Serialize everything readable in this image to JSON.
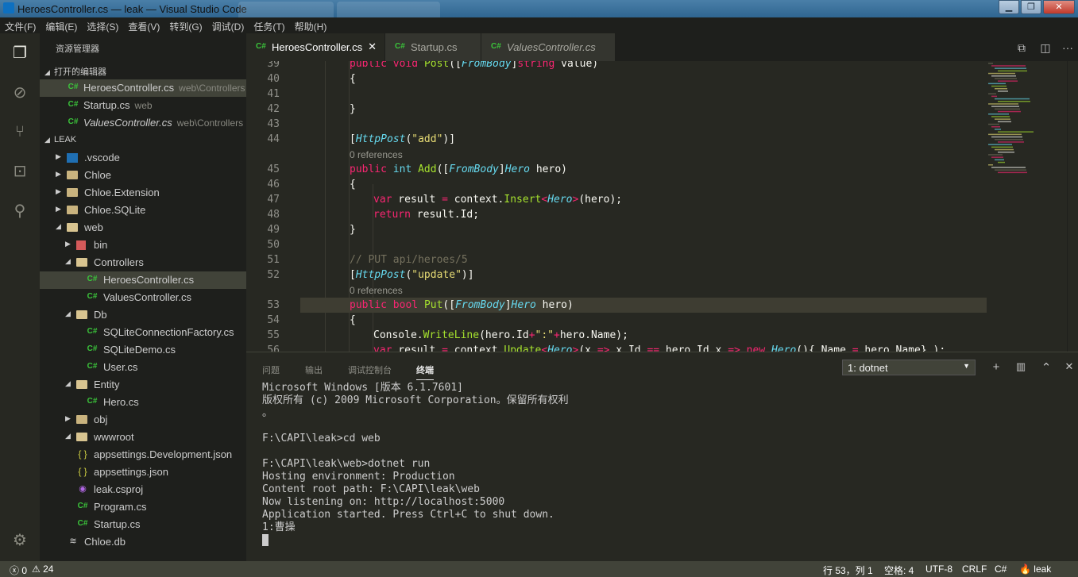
{
  "window": {
    "title": "HeroesController.cs — leak — Visual Studio Code",
    "controls": [
      "minimize",
      "maximize",
      "close"
    ]
  },
  "menu": [
    "文件(F)",
    "编辑(E)",
    "选择(S)",
    "查看(V)",
    "转到(G)",
    "调试(D)",
    "任务(T)",
    "帮助(H)"
  ],
  "activity": [
    "explorer-icon",
    "debug-icon",
    "source-control-icon",
    "extensions-icon",
    "search-icon",
    "gear-icon"
  ],
  "sidebar": {
    "title": "资源管理器",
    "open_editors_title": "打开的编辑器",
    "open_editors": [
      {
        "name": "HeroesController.cs",
        "desc": "web\\Controllers",
        "italic": false
      },
      {
        "name": "Startup.cs",
        "desc": "web",
        "italic": false
      },
      {
        "name": "ValuesController.cs",
        "desc": "web\\Controllers",
        "italic": true
      }
    ],
    "project_title": "LEAK",
    "tree": [
      {
        "name": ".vscode",
        "icon": "vscode",
        "depth": 1,
        "caret": "▶"
      },
      {
        "name": "Chloe",
        "icon": "folder",
        "depth": 1,
        "caret": "▶"
      },
      {
        "name": "Chloe.Extension",
        "icon": "folder",
        "depth": 1,
        "caret": "▶"
      },
      {
        "name": "Chloe.SQLite",
        "icon": "folder",
        "depth": 1,
        "caret": "▶"
      },
      {
        "name": "web",
        "icon": "folder-open",
        "depth": 1,
        "caret": "◢"
      },
      {
        "name": "bin",
        "icon": "bin",
        "depth": 2,
        "caret": "▶"
      },
      {
        "name": "Controllers",
        "icon": "folder-open",
        "depth": 2,
        "caret": "◢"
      },
      {
        "name": "HeroesController.cs",
        "icon": "cs",
        "depth": 3,
        "caret": "",
        "selected": true
      },
      {
        "name": "ValuesController.cs",
        "icon": "cs",
        "depth": 3,
        "caret": ""
      },
      {
        "name": "Db",
        "icon": "folder-open",
        "depth": 2,
        "caret": "◢"
      },
      {
        "name": "SQLiteConnectionFactory.cs",
        "icon": "cs",
        "depth": 3,
        "caret": ""
      },
      {
        "name": "SQLiteDemo.cs",
        "icon": "cs",
        "depth": 3,
        "caret": ""
      },
      {
        "name": "User.cs",
        "icon": "cs",
        "depth": 3,
        "caret": ""
      },
      {
        "name": "Entity",
        "icon": "folder-open",
        "depth": 2,
        "caret": "◢"
      },
      {
        "name": "Hero.cs",
        "icon": "cs",
        "depth": 3,
        "caret": ""
      },
      {
        "name": "obj",
        "icon": "folder",
        "depth": 2,
        "caret": "▶"
      },
      {
        "name": "wwwroot",
        "icon": "folder-open",
        "depth": 2,
        "caret": "◢"
      },
      {
        "name": "appsettings.Development.json",
        "icon": "json",
        "depth": 2,
        "caret": ""
      },
      {
        "name": "appsettings.json",
        "icon": "json",
        "depth": 2,
        "caret": ""
      },
      {
        "name": "leak.csproj",
        "icon": "csproj",
        "depth": 2,
        "caret": ""
      },
      {
        "name": "Program.cs",
        "icon": "cs",
        "depth": 2,
        "caret": ""
      },
      {
        "name": "Startup.cs",
        "icon": "cs",
        "depth": 2,
        "caret": ""
      },
      {
        "name": "Chloe.db",
        "icon": "db",
        "depth": 1,
        "caret": ""
      }
    ]
  },
  "tabs": [
    {
      "label": "HeroesController.cs",
      "active": true,
      "italic": false,
      "close": "✕"
    },
    {
      "label": "Startup.cs",
      "active": false,
      "italic": false,
      "close": ""
    },
    {
      "label": "ValuesController.cs",
      "active": false,
      "italic": true,
      "close": ""
    }
  ],
  "editor": {
    "lines": [
      {
        "num": "39",
        "indent": 2,
        "html": "<span class=\"kw\">public</span> <span class=\"kw\">void</span> <span class=\"fn\">Post</span>([<span class=\"tp\">FromBody</span>]<span class=\"kw\">string</span> value)"
      },
      {
        "num": "40",
        "indent": 2,
        "html": "{"
      },
      {
        "num": "41",
        "indent": 2,
        "html": ""
      },
      {
        "num": "42",
        "indent": 2,
        "html": "}"
      },
      {
        "num": "43",
        "indent": 2,
        "html": ""
      },
      {
        "num": "44",
        "indent": 2,
        "html": "[<span class=\"tp\">HttpPost</span>(<span class=\"st\">\"add\"</span>)]"
      },
      {
        "lens": "0 references"
      },
      {
        "num": "45",
        "indent": 2,
        "html": "<span class=\"kw\">public</span> <span class=\"tp\" style=\"font-style:normal\">int</span> <span class=\"fn\">Add</span>([<span class=\"tp\">FromBody</span>]<span class=\"tp\">Hero</span> hero)"
      },
      {
        "num": "46",
        "indent": 2,
        "html": "{"
      },
      {
        "num": "47",
        "indent": 3,
        "html": "<span class=\"kw\">var</span> result <span class=\"op\">=</span> context.<span class=\"fn\">Insert</span><span class=\"op\">&lt;</span><span class=\"tp\">Hero</span><span class=\"op\">&gt;</span>(hero);"
      },
      {
        "num": "48",
        "indent": 3,
        "html": "<span class=\"kw\">return</span> result.Id;"
      },
      {
        "num": "49",
        "indent": 2,
        "html": "}"
      },
      {
        "num": "50",
        "indent": 2,
        "html": ""
      },
      {
        "num": "51",
        "indent": 2,
        "html": "<span class=\"cm\">// PUT api/heroes/5</span>"
      },
      {
        "num": "52",
        "indent": 2,
        "html": "[<span class=\"tp\">HttpPost</span>(<span class=\"st\">\"update\"</span>)]"
      },
      {
        "lens": "0 references"
      },
      {
        "num": "53",
        "indent": 2,
        "highlight": true,
        "html": "<span class=\"kw\">public</span> <span class=\"kw\">bool</span> <span class=\"fn\">Put</span>([<span class=\"tp\">FromBody</span>]<span class=\"tp\">Hero</span> hero)"
      },
      {
        "num": "54",
        "indent": 2,
        "html": "{"
      },
      {
        "num": "55",
        "indent": 3,
        "html": "Console.<span class=\"fn\">WriteLine</span>(hero.Id<span class=\"op\">+</span><span class=\"st\">\":\"</span><span class=\"op\">+</span>hero.Name);"
      },
      {
        "num": "56",
        "indent": 3,
        "html": "<span class=\"kw\">var</span> result <span class=\"op\">=</span> context.<span class=\"fn\">Update</span><span class=\"op\">&lt;</span><span class=\"tp\">Hero</span><span class=\"op\">&gt;</span>(x <span class=\"op\">=&gt;</span> x.Id <span class=\"op\">==</span> hero.Id,x <span class=\"op\">=&gt;</span> <span class=\"kw\">new</span> <span class=\"tp\">Hero</span>(){ Name <span class=\"op\">=</span> hero.Name} );"
      }
    ]
  },
  "panel": {
    "tabs": [
      "问题",
      "输出",
      "调试控制台",
      "终端"
    ],
    "active_tab": 3,
    "terminal_select": "1: dotnet",
    "actions": [
      "+",
      "🗑",
      "︿",
      "✕"
    ],
    "terminal_lines": [
      "Microsoft Windows [版本 6.1.7601]",
      "版权所有 (c) 2009 Microsoft Corporation。保留所有权利",
      "。",
      "",
      "F:\\CAPI\\leak>cd web",
      "",
      "F:\\CAPI\\leak\\web>dotnet run",
      "Hosting environment: Production",
      "Content root path: F:\\CAPI\\leak\\web",
      "Now listening on: http://localhost:5000",
      "Application started. Press Ctrl+C to shut down.",
      "1:曹操"
    ]
  },
  "status": {
    "errors": "0",
    "warnings": "24",
    "position": "行 53，列 1",
    "spaces": "空格: 4",
    "encoding": "UTF-8",
    "eol": "CRLF",
    "language": "C#",
    "project": "leak"
  },
  "colors": {
    "accent": "#3bc43b",
    "background": "#272822",
    "sidebar": "#1e1f1c",
    "statusbar": "#414339"
  }
}
